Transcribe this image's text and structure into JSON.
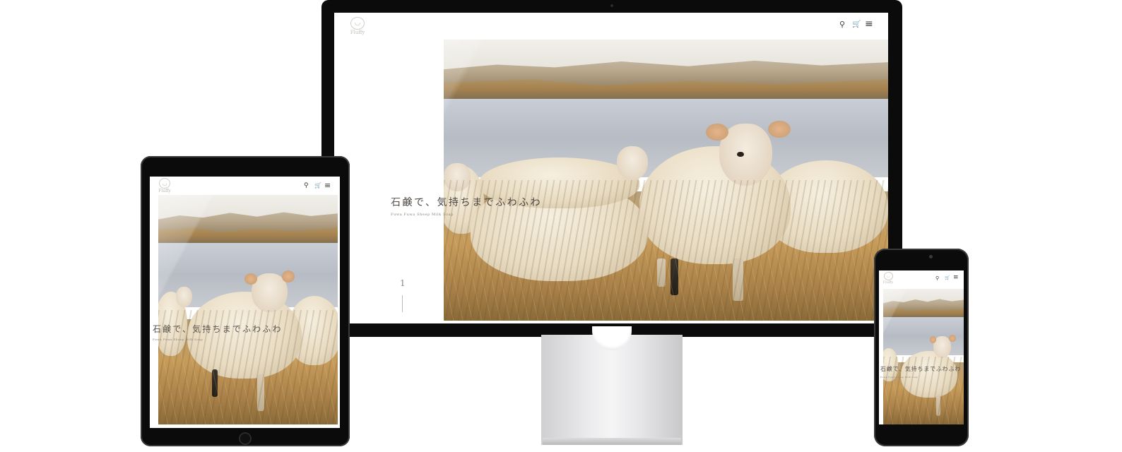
{
  "site": {
    "logo_text": "Fluffy",
    "headline": "石鹸で、気持ちまでふわふわ",
    "subline": "Fuwa Fuwa Sheep Milk Soap",
    "scroll_number": "1"
  },
  "nav": {
    "search_icon": "search-icon",
    "cart_icon": "cart-icon",
    "menu_icon": "menu-icon",
    "search_glyph": "⚲",
    "cart_glyph": "🛒",
    "menu_glyph": "≡"
  },
  "colors": {
    "bezel": "#0b0b0b",
    "screen_bg": "#ffffff",
    "headline_text": "#4b4540",
    "stand_silver": "#e6e6e8"
  }
}
